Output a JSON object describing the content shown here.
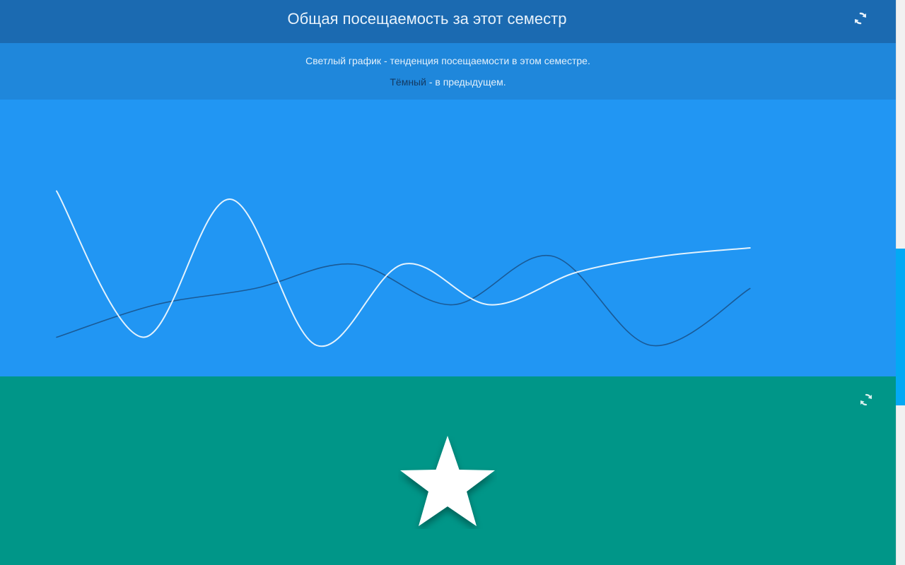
{
  "header": {
    "title": "Общая посещаемость за этот семестр",
    "refresh_icon": "refresh-icon"
  },
  "legend": {
    "line1": "Светлый график - тенденция посещаемости в этом семестре.",
    "line2_dark_word": "Тёмный",
    "line2_rest": " - в предыдущем."
  },
  "chart_data": {
    "type": "line",
    "x": [
      0,
      1,
      2,
      3,
      4,
      5,
      6,
      7,
      8
    ],
    "series": [
      {
        "values": [
          0.95,
          0.05,
          0.9,
          0.0,
          0.5,
          0.25,
          0.45,
          0.55,
          0.6
        ],
        "color": "#e3f2fd"
      },
      {
        "values": [
          0.05,
          0.25,
          0.35,
          0.5,
          0.25,
          0.55,
          0.0,
          0.35
        ],
        "color": "#1a5a96"
      }
    ],
    "ylim": [
      0,
      1
    ],
    "grid": false,
    "axes_visible": false
  },
  "favorites_panel": {
    "refresh_icon": "refresh-icon",
    "star_icon": "star-icon"
  },
  "colors": {
    "header": "#1b6ab1",
    "legend_band": "#1f87db",
    "chart_bg": "#2196f3",
    "panel_green": "#009688",
    "scroll_thumb": "#03a9f4"
  }
}
